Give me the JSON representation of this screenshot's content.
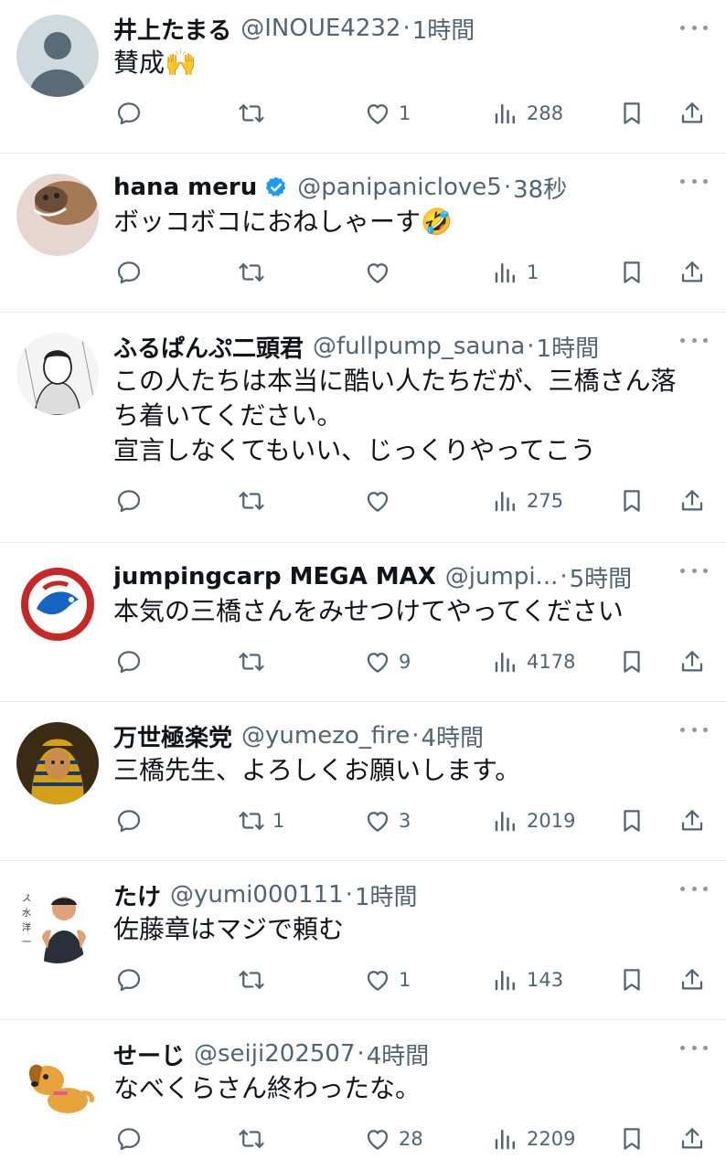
{
  "tweets": [
    {
      "name": "井上たまる",
      "handle": "@INOUE4232",
      "time": "1時間",
      "text": "賛成🙌",
      "verified": false,
      "avatar": "default-avatar",
      "replies": "",
      "retweets": "",
      "likes": "1",
      "views": "288"
    },
    {
      "name": "hana meru",
      "handle": "@panipaniclove5",
      "time": "38秒",
      "text": "ボッコボコにおねしゃーす🤣",
      "verified": true,
      "avatar": "cat-avatar",
      "replies": "",
      "retweets": "",
      "likes": "",
      "views": "1"
    },
    {
      "name": "ふるぱんぷ二頭君",
      "handle": "@fullpump_sauna",
      "time": "1時間",
      "text": "この人たちは本当に酷い人たちだが、三橋さん落\nち着いてください。\n宣言しなくてもいい、じっくりやってこう",
      "verified": false,
      "avatar": "manga-avatar",
      "replies": "",
      "retweets": "",
      "likes": "",
      "views": "275"
    },
    {
      "name": "jumpingcarp MEGA MAX",
      "handle": "@jumpi...",
      "time": "5時間",
      "text": "本気の三橋さんをみせつけてやってください",
      "verified": false,
      "avatar": "carp-avatar",
      "replies": "",
      "retweets": "",
      "likes": "9",
      "views": "4178"
    },
    {
      "name": "万世極楽党",
      "handle": "@yumezo_fire",
      "time": "4時間",
      "text": "三橋先生、よろしくお願いします。",
      "verified": false,
      "avatar": "pharaoh-avatar",
      "replies": "",
      "retweets": "1",
      "likes": "3",
      "views": "2019"
    },
    {
      "name": "たけ",
      "handle": "@yumi000111",
      "time": "1時間",
      "text": "佐藤章はマジで頼む",
      "verified": false,
      "avatar": "man-avatar",
      "replies": "",
      "retweets": "",
      "likes": "1",
      "views": "143"
    },
    {
      "name": "せーじ",
      "handle": "@seiji202507",
      "time": "4時間",
      "text": "なべくらさん終わったな。",
      "verified": false,
      "avatar": "dog-avatar",
      "replies": "",
      "retweets": "",
      "likes": "28",
      "views": "2209"
    }
  ],
  "colors": {
    "text": "#0f1419",
    "secondary": "#536471",
    "verified": "#1d9bf0",
    "divider": "#e7e9ea"
  },
  "icons": {
    "reply": "reply-icon",
    "retweet": "retweet-icon",
    "like": "heart-icon",
    "views": "views-icon",
    "bookmark": "bookmark-icon",
    "share": "share-icon",
    "more": "more-icon"
  }
}
